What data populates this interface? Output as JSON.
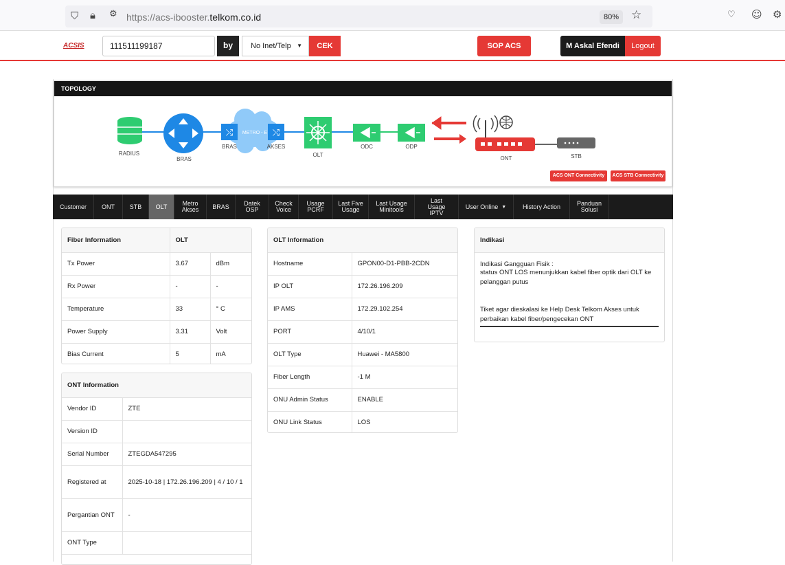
{
  "browser": {
    "url_prefix": "https://acs-ibooster.",
    "url_domain": "telkom.co.id",
    "zoom": "80%"
  },
  "header": {
    "logo": "ACSIS",
    "search_value": "111511199187",
    "by_label": "by",
    "select_value": "No Inet/Telp",
    "cek_label": "CEK",
    "sop_label": "SOP ACS",
    "user_name": "M Askal Efendi",
    "logout_label": "Logout"
  },
  "topology": {
    "title": "TOPOLOGY",
    "nodes": {
      "radius": "RADIUS",
      "bras": "BRAS",
      "bras2": "BRAS",
      "metro": "METRO - E",
      "akses": "AKSES",
      "olt": "OLT",
      "odc": "ODC",
      "odp": "ODP",
      "ont": "ONT",
      "stb": "STB"
    },
    "acs_ont_btn": "ACS ONT Connectivity",
    "acs_stb_btn": "ACS STB Connectivity"
  },
  "tabs": [
    "Customer",
    "ONT",
    "STB",
    "OLT",
    "Metro Akses",
    "BRAS",
    "Datek OSP",
    "Check Voice",
    "Usage PCRF",
    "Last Five Usage",
    "Last Usage Minitools",
    "Last Usage IPTV",
    "User Online",
    "History Action",
    "Panduan Solusi"
  ],
  "fiber": {
    "header": [
      "Fiber Information",
      "OLT"
    ],
    "rows": [
      [
        "Tx Power",
        "3.67",
        "dBm"
      ],
      [
        "Rx Power",
        "-",
        "-"
      ],
      [
        "Temperature",
        "33",
        "° C"
      ],
      [
        "Power Supply",
        "3.31",
        "Volt"
      ],
      [
        "Bias Current",
        "5",
        "mA"
      ]
    ]
  },
  "ont": {
    "header": "ONT Information",
    "rows": [
      [
        "Vendor ID",
        "ZTE"
      ],
      [
        "Version ID",
        ""
      ],
      [
        "Serial Number",
        "ZTEGDA547295"
      ],
      [
        "Registered at",
        "2025-10-18 | 172.26.196.209 | 4 / 10 / 1"
      ],
      [
        "Pergantian ONT",
        "-"
      ],
      [
        "ONT Type",
        ""
      ]
    ]
  },
  "olt": {
    "header": "OLT Information",
    "rows": [
      [
        "Hostname",
        "GPON00-D1-PBB-2CDN"
      ],
      [
        "IP OLT",
        "172.26.196.209"
      ],
      [
        "IP AMS",
        "172.29.102.254"
      ],
      [
        "PORT",
        "4/10/1"
      ],
      [
        "OLT Type",
        "Huawei - MA5800"
      ],
      [
        "Fiber Length",
        "-1 M"
      ],
      [
        "ONU Admin Status",
        "ENABLE"
      ],
      [
        "ONU Link Status",
        "LOS"
      ]
    ]
  },
  "indikasi": {
    "header": "Indikasi",
    "line1": "Indikasi Gangguan Fisik :",
    "line2": "status ONT LOS menunjukkan kabel fiber optik dari OLT ke pelanggan putus",
    "line3": "Tiket agar dieskalasi ke Help Desk Telkom Akses untuk perbaikan kabel fiber/pengecekan ONT"
  },
  "colors": {
    "accent_red": "#e53935",
    "dark": "#1b1b1b",
    "green": "#2ecc71",
    "blue": "#1e88e5"
  }
}
